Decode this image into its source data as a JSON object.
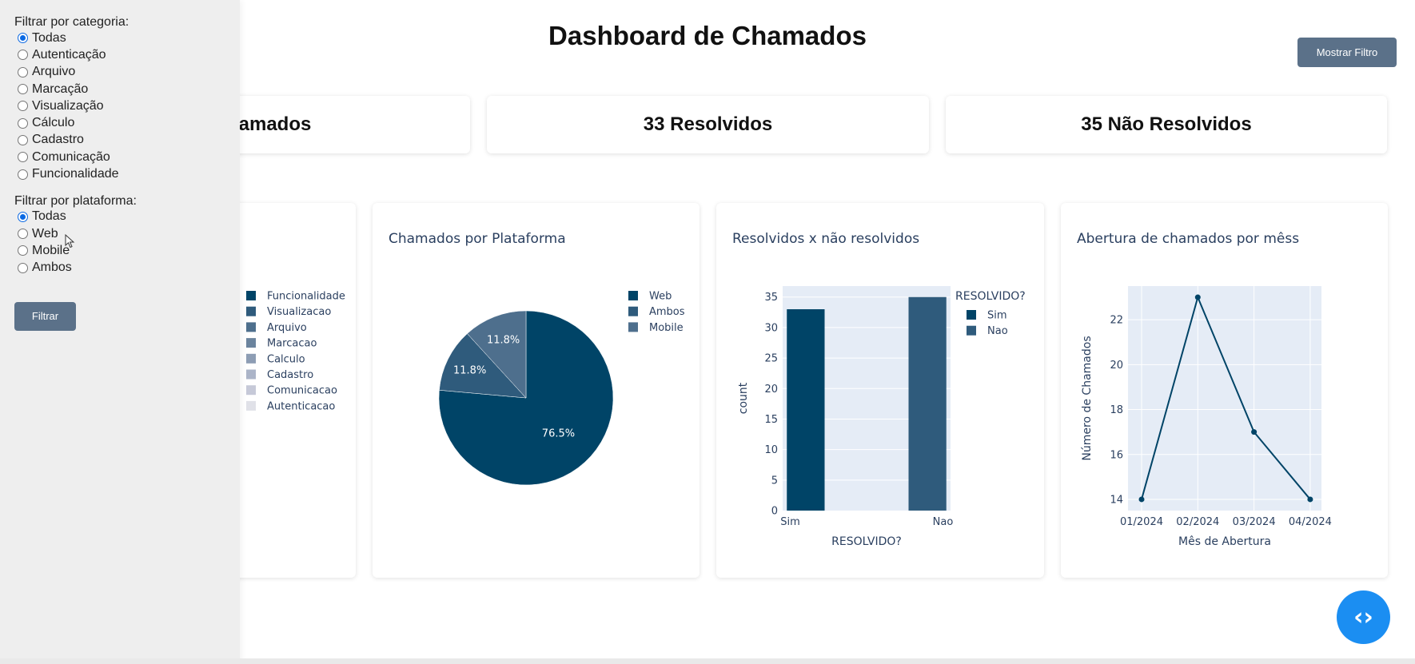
{
  "dashboard": {
    "title": "Dashboard de Chamados",
    "show_filter_label": "Mostrar Filtro"
  },
  "kpis": {
    "total": "amados",
    "resolved": "33 Resolvidos",
    "unresolved": "35 Não Resolvidos"
  },
  "sidebar": {
    "category_label": "Filtrar por categoria:",
    "category_options": [
      "Todas",
      "Autenticação",
      "Arquivo",
      "Marcação",
      "Visualização",
      "Cálculo",
      "Cadastro",
      "Comunicação",
      "Funcionalidade"
    ],
    "category_selected": "Todas",
    "platform_label": "Filtrar por plataforma:",
    "platform_options": [
      "Todas",
      "Web",
      "Mobile",
      "Ambos"
    ],
    "platform_selected": "Todas",
    "filter_button": "Filtrar"
  },
  "colors": {
    "c1": "#004467",
    "c2": "#2f5b7c",
    "c3": "#4e6f8d",
    "c4": "#6b849e",
    "c5": "#8d9db4",
    "c6": "#abb4c8",
    "c7": "#c6c9d8",
    "c8": "#e0e1e8",
    "plot_bg": "#e5ecf6",
    "title_text": "#2a3f5f",
    "button": "#5b7189",
    "fab": "#1b8ef2"
  },
  "chart_data": [
    {
      "type": "pie",
      "title": "",
      "legend": [
        "Funcionalidade",
        "Visualizacao",
        "Arquivo",
        "Marcacao",
        "Calculo",
        "Cadastro",
        "Comunicacao",
        "Autenticacao"
      ]
    },
    {
      "type": "pie",
      "title": "Chamados por Plataforma",
      "labels": [
        "Web",
        "Ambos",
        "Mobile"
      ],
      "values": [
        76.5,
        11.8,
        11.8
      ],
      "text_labels": [
        "76.5%",
        "11.8%",
        "11.8%"
      ],
      "legend_position": "top-right"
    },
    {
      "type": "bar",
      "title": "Resolvidos x não resolvidos",
      "categories": [
        "Sim",
        "Nao"
      ],
      "series": [
        {
          "name": "Sim",
          "values": [
            33,
            null
          ]
        },
        {
          "name": "Nao",
          "values": [
            null,
            35
          ]
        }
      ],
      "xlabel": "RESOLVIDO?",
      "ylabel": "count",
      "legend_title": "RESOLVIDO?",
      "ylim": [
        0,
        36.8
      ],
      "yticks": [
        0,
        5,
        10,
        15,
        20,
        25,
        30,
        35
      ]
    },
    {
      "type": "line",
      "title": "Abertura de chamados por mêss",
      "x": [
        "01/2024",
        "02/2024",
        "03/2024",
        "04/2024"
      ],
      "y": [
        14,
        23,
        17,
        14
      ],
      "xlabel": "Mês de Abertura",
      "ylabel": "Número de Chamados",
      "ylim": [
        13.5,
        23.5
      ],
      "yticks": [
        14,
        16,
        18,
        20,
        22
      ]
    }
  ]
}
